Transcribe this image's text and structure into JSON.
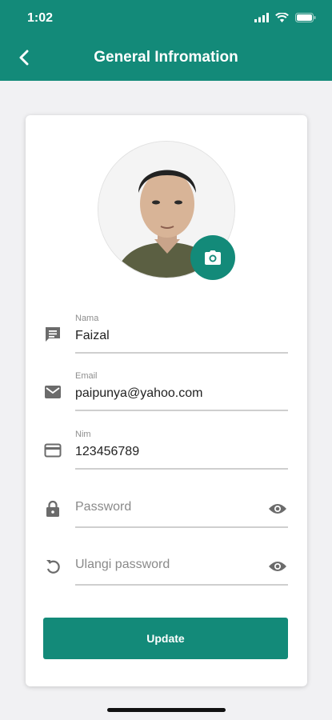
{
  "status_bar": {
    "time": "1:02"
  },
  "header": {
    "title": "General Infromation"
  },
  "profile": {
    "photo_alt": "Profile photo"
  },
  "form": {
    "nama": {
      "label": "Nama",
      "value": "Faizal"
    },
    "email": {
      "label": "Email",
      "value": "paipunya@yahoo.com"
    },
    "nim": {
      "label": "Nim",
      "value": "123456789"
    },
    "password": {
      "placeholder": "Password"
    },
    "ulangi_password": {
      "placeholder": "Ulangi password"
    }
  },
  "actions": {
    "update_label": "Update"
  },
  "colors": {
    "primary": "#138a79",
    "icon_gray": "#6b6b6b",
    "background": "#f1f1f3"
  },
  "icons": [
    "back-arrow-icon",
    "camera-icon",
    "message-icon",
    "mail-icon",
    "credit-card-icon",
    "lock-icon",
    "history-icon",
    "eye-icon"
  ]
}
